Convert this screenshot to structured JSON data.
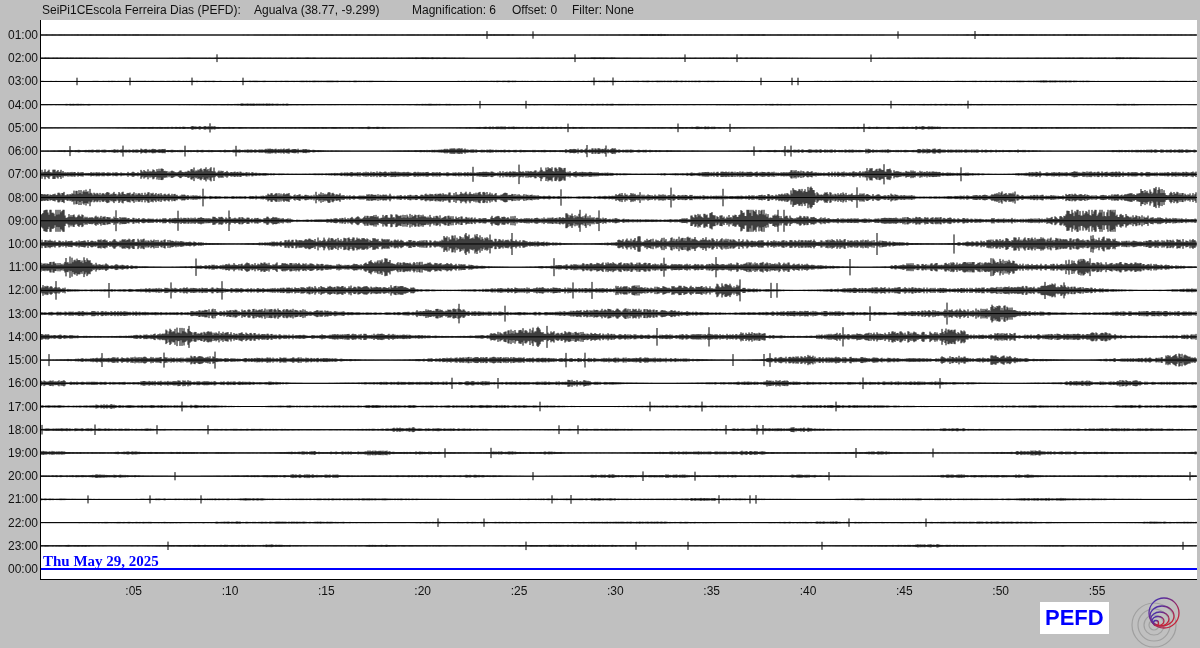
{
  "header": {
    "station": "SeiPi1CEscola Ferreira Dias (PEFD):",
    "location": "Agualva (38.77, -9.299)",
    "magnification": "Magnification: 6",
    "offset": "Offset: 0",
    "filter": "Filter: None"
  },
  "rows": [
    {
      "label": "01:00",
      "current": false
    },
    {
      "label": "02:00",
      "current": false
    },
    {
      "label": "03:00",
      "current": false
    },
    {
      "label": "04:00",
      "current": false
    },
    {
      "label": "05:00",
      "current": false
    },
    {
      "label": "06:00",
      "current": false
    },
    {
      "label": "07:00",
      "current": false
    },
    {
      "label": "08:00",
      "current": false
    },
    {
      "label": "09:00",
      "current": false
    },
    {
      "label": "10:00",
      "current": false
    },
    {
      "label": "11:00",
      "current": false
    },
    {
      "label": "12:00",
      "current": false
    },
    {
      "label": "13:00",
      "current": false
    },
    {
      "label": "14:00",
      "current": false
    },
    {
      "label": "15:00",
      "current": false
    },
    {
      "label": "16:00",
      "current": false
    },
    {
      "label": "17:00",
      "current": false
    },
    {
      "label": "18:00",
      "current": false
    },
    {
      "label": "19:00",
      "current": false
    },
    {
      "label": "20:00",
      "current": false
    },
    {
      "label": "21:00",
      "current": false
    },
    {
      "label": "22:00",
      "current": false
    },
    {
      "label": "23:00",
      "current": false
    },
    {
      "label": "00:00",
      "current": true
    }
  ],
  "date_label": "Thu May 29, 2025",
  "x_ticks": [
    ":05",
    ":10",
    ":15",
    ":20",
    ":25",
    ":30",
    ":35",
    ":40",
    ":45",
    ":50",
    ":55"
  ],
  "station_badge": "PEFD"
}
